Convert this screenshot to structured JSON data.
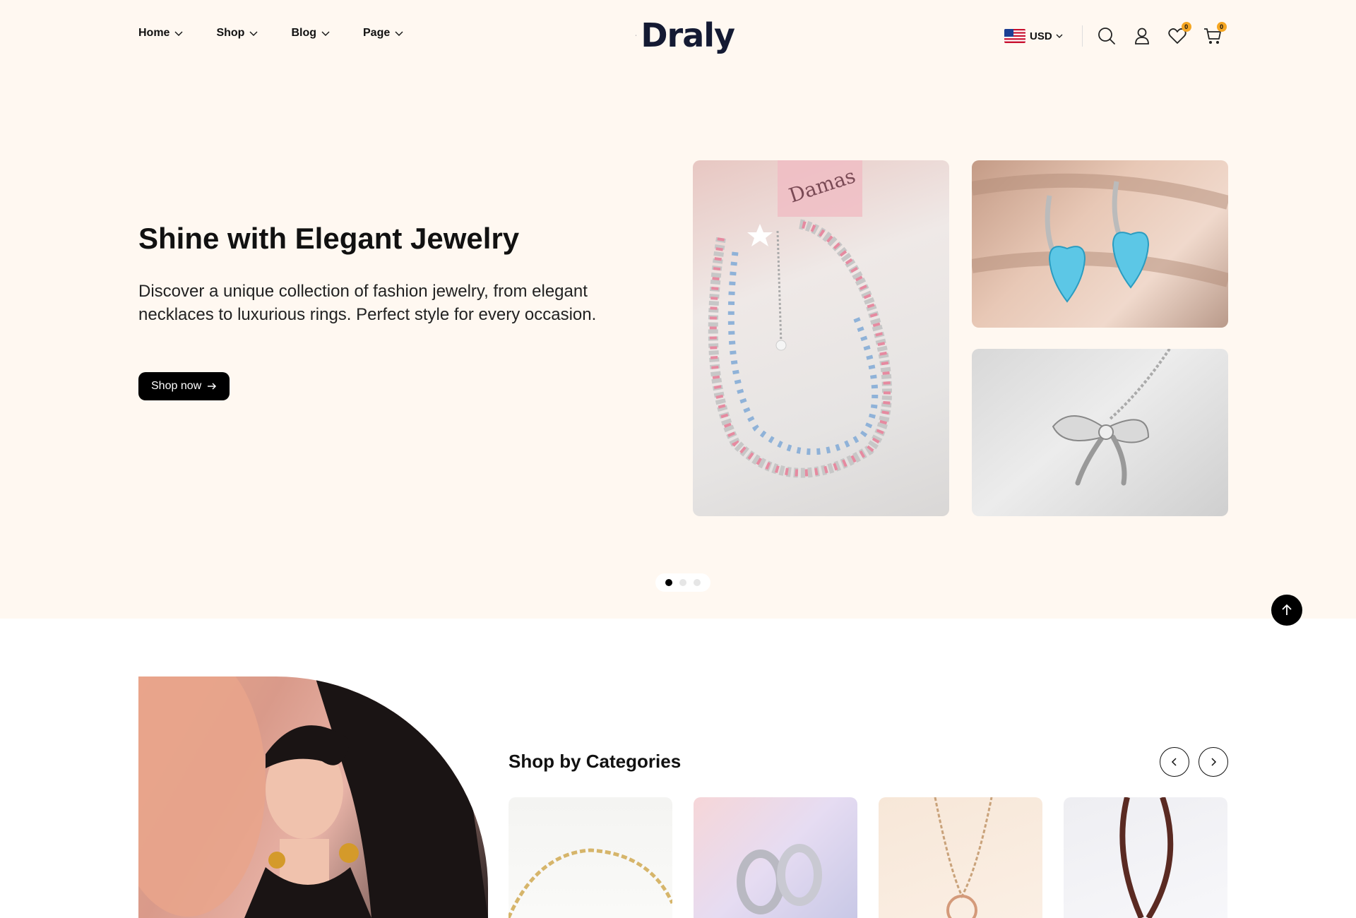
{
  "header": {
    "nav": [
      {
        "label": "Home"
      },
      {
        "label": "Shop"
      },
      {
        "label": "Blog"
      },
      {
        "label": "Page"
      }
    ],
    "logo_text": "Draly",
    "currency": "USD",
    "wishlist_count": "0",
    "cart_count": "0"
  },
  "hero": {
    "title": "Shine with Elegant Jewelry",
    "description": "Discover a unique collection of fashion jewelry, from elegant necklaces to luxurious rings. Perfect style for every occasion.",
    "cta_label": "Shop now",
    "image_brand_text": "Damas"
  },
  "categories": {
    "title": "Shop by Categories"
  },
  "colors": {
    "hero_bg": "#fff8f1",
    "badge": "#f5a623",
    "primary": "#000000",
    "logo": "#141a33"
  },
  "icons": [
    "chevron-down-icon",
    "search-icon",
    "user-icon",
    "heart-icon",
    "cart-icon",
    "arrow-right-icon",
    "arrow-up-icon",
    "chevron-left-icon",
    "chevron-right-icon"
  ]
}
